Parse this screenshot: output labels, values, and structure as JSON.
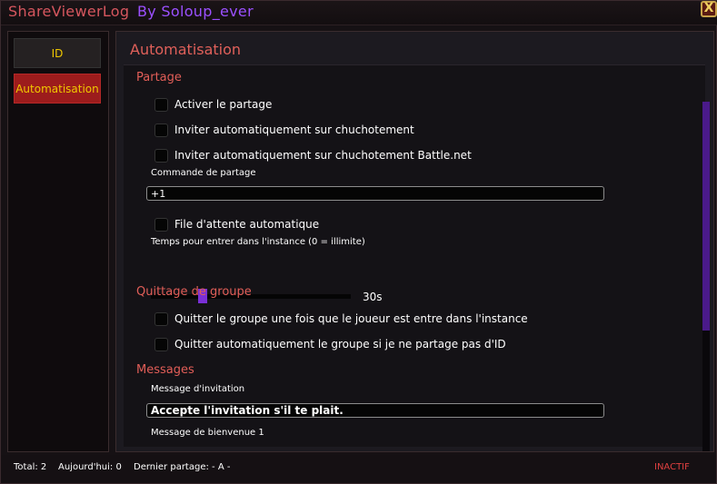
{
  "window": {
    "title_app": "ShareViewerLog",
    "title_author": "By Soloup_ever",
    "close_label": "X"
  },
  "sidebar": {
    "items": [
      {
        "label": "ID"
      },
      {
        "label": "Automatisation"
      }
    ]
  },
  "main": {
    "title": "Automatisation",
    "sections": {
      "partage": "Partage",
      "quittage": "Quittage de groupe",
      "messages": "Messages"
    },
    "checkboxes": {
      "activer": {
        "label": "Activer le partage",
        "checked": false
      },
      "inviter": {
        "label": "Inviter automatiquement sur chuchotement",
        "checked": false
      },
      "inviter_bnet": {
        "label": "Inviter automatiquement sur chuchotement Battle.net",
        "checked": false
      },
      "file_attente": {
        "label": "File d'attente automatique",
        "checked": false
      },
      "quitter_entre": {
        "label": "Quitter le groupe une fois que le joueur est entre dans l'instance",
        "checked": false
      },
      "quitter_auto": {
        "label": "Quitter automatiquement le groupe si je ne partage pas d'ID",
        "checked": false
      }
    },
    "commande": {
      "label": "Commande de partage",
      "value": "+1"
    },
    "temps": {
      "label": "Temps pour entrer dans l'instance (0 = illimite)",
      "value_text": "30s"
    },
    "message_invitation": {
      "label": "Message d'invitation",
      "value": "Accepte l'invitation s'il te plait."
    },
    "message_bienvenue": {
      "label": "Message de bienvenue 1"
    }
  },
  "status": {
    "total": "Total: 2",
    "aujourdhui": "Aujourd'hui: 0",
    "dernier": "Dernier partage: - A -",
    "state": "INACTIF"
  },
  "colors": {
    "accent_red": "#e25e58",
    "accent_purple": "#9b50ff",
    "gold": "#f0c800"
  }
}
